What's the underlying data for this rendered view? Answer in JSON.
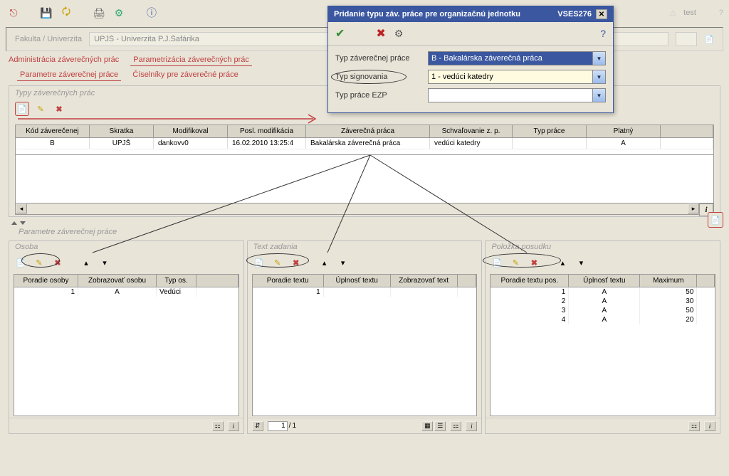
{
  "toolbar": {
    "warn_label": "test"
  },
  "filter": {
    "label": "Fakulta / Univerzita",
    "value": "UPJŠ - Univerzita P.J.Šafárika"
  },
  "main_tabs": [
    {
      "label": "Administrácia záverečných prác",
      "active": false
    },
    {
      "label": "Parametrizácia záverečných prác",
      "active": true
    }
  ],
  "sub_tabs": [
    {
      "label": "Parametre záverečnej práce",
      "active": true
    },
    {
      "label": "Číselníky pre záverečné práce",
      "active": false
    }
  ],
  "types_section": {
    "title": "Typy záverečných prác",
    "columns": [
      "Kód záverečenej",
      "Skratka",
      "Modifikoval",
      "Posl. modifikácia",
      "Záverečná práca",
      "Schvaľovanie z. p.",
      "Typ práce",
      "Platný"
    ],
    "row": {
      "kod": "B",
      "skratka": "UPJŠ",
      "modifikoval": "dankovv0",
      "posl": "16.02.2010 13:25:4",
      "zaverecna": "Bakalárska záverečná práca",
      "schvalovanie": "vedúci katedry",
      "typ": "",
      "platny": "A"
    },
    "info": "i"
  },
  "params_section_title": "Parametre záverečnej práce",
  "panels": {
    "osoba": {
      "title": "Osoba",
      "columns": [
        "Poradie osoby",
        "Zobrazovať osobu",
        "Typ os."
      ],
      "rows": [
        {
          "poradie": "1",
          "zobraz": "A",
          "typ": "Vedúci"
        }
      ]
    },
    "text": {
      "title": "Text zadania",
      "columns": [
        "Poradie textu",
        "Úplnosť textu",
        "Zobrazovať text"
      ],
      "rows": [
        {
          "poradie": "1",
          "uplnost": "",
          "zobraz": ""
        }
      ],
      "pager": {
        "current": "1",
        "total": "1"
      }
    },
    "polozka": {
      "title": "Položka posudku",
      "columns": [
        "Poradie textu pos.",
        "Úplnosť textu",
        "Maximum"
      ],
      "rows": [
        {
          "poradie": "1",
          "uplnost": "A",
          "max": "50"
        },
        {
          "poradie": "2",
          "uplnost": "A",
          "max": "30"
        },
        {
          "poradie": "3",
          "uplnost": "A",
          "max": "50"
        },
        {
          "poradie": "4",
          "uplnost": "A",
          "max": "20"
        }
      ]
    }
  },
  "dialog": {
    "title": "Pridanie typu záv. práce pre organizačnú jednotku",
    "code": "VSES276",
    "field1": {
      "label": "Typ záverečnej práce",
      "value": "B - Bakalárska záverečná práca"
    },
    "field2": {
      "label": "Typ signovania",
      "value": "1 - vedúci katedry"
    },
    "field3": {
      "label": "Typ práce EZP",
      "value": ""
    }
  }
}
